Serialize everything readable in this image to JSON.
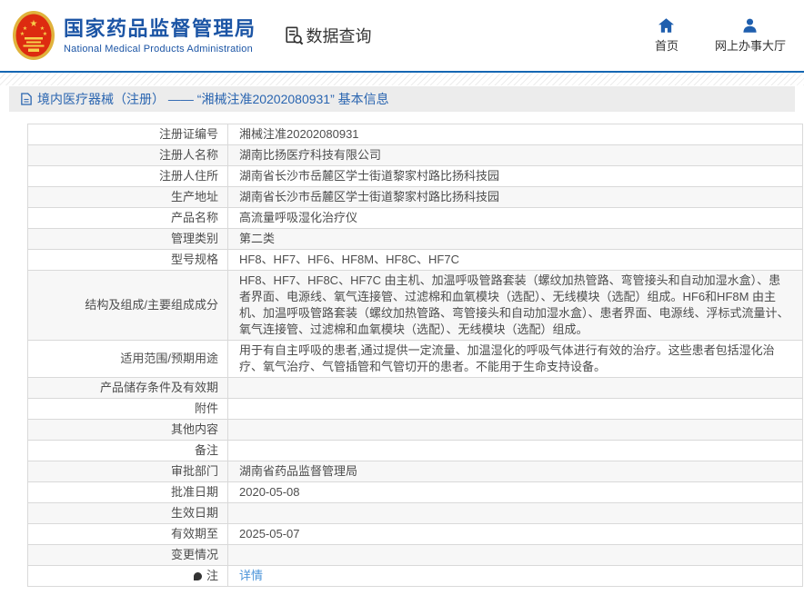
{
  "header": {
    "org_name_cn": "国家药品监督管理局",
    "org_name_en": "National Medical Products Administration",
    "section_title": "数据查询",
    "nav": [
      {
        "label": "首页",
        "icon": "home-icon"
      },
      {
        "label": "网上办事大厅",
        "icon": "person-icon"
      }
    ]
  },
  "breadcrumb": {
    "text": "境内医疗器械（注册） —— “湘械注准20202080931” 基本信息"
  },
  "table": {
    "rows": [
      {
        "label": "注册证编号",
        "value": "湘械注准20202080931"
      },
      {
        "label": "注册人名称",
        "value": "湖南比扬医疗科技有限公司"
      },
      {
        "label": "注册人住所",
        "value": "湖南省长沙市岳麓区学士街道黎家村路比扬科技园"
      },
      {
        "label": "生产地址",
        "value": "湖南省长沙市岳麓区学士街道黎家村路比扬科技园"
      },
      {
        "label": "产品名称",
        "value": "高流量呼吸湿化治疗仪"
      },
      {
        "label": "管理类别",
        "value": "第二类"
      },
      {
        "label": "型号规格",
        "value": "HF8、HF7、HF6、HF8M、HF8C、HF7C"
      },
      {
        "label": "结构及组成/主要组成成分",
        "value": "HF8、HF7、HF8C、HF7C 由主机、加温呼吸管路套装（螺纹加热管路、弯管接头和自动加湿水盒）、患者界面、电源线、氧气连接管、过滤棉和血氧模块（选配）、无线模块（选配）组成。HF6和HF8M 由主机、加温呼吸管路套装（螺纹加热管路、弯管接头和自动加湿水盒）、患者界面、电源线、浮标式流量计、氧气连接管、过滤棉和血氧模块（选配）、无线模块（选配）组成。"
      },
      {
        "label": "适用范围/预期用途",
        "value": "用于有自主呼吸的患者,通过提供一定流量、加温湿化的呼吸气体进行有效的治疗。这些患者包括湿化治疗、氧气治疗、气管插管和气管切开的患者。不能用于生命支持设备。"
      },
      {
        "label": "产品储存条件及有效期",
        "value": ""
      },
      {
        "label": "附件",
        "value": ""
      },
      {
        "label": "其他内容",
        "value": ""
      },
      {
        "label": "备注",
        "value": ""
      },
      {
        "label": "审批部门",
        "value": "湖南省药品监督管理局"
      },
      {
        "label": "批准日期",
        "value": "2020-05-08"
      },
      {
        "label": "生效日期",
        "value": ""
      },
      {
        "label": "有效期至",
        "value": "2025-05-07"
      },
      {
        "label": "变更情况",
        "value": ""
      },
      {
        "label": "注",
        "value": "详情"
      }
    ]
  },
  "colors": {
    "brand_blue": "#1c55a5",
    "rule_blue": "#1567b3",
    "icon_blue": "#1f5fae",
    "breadcrumb_blue": "#2a65b0",
    "link_blue": "#4c94d9",
    "stripe_gray": "#f7f7f7",
    "border_gray": "#d9d9d9",
    "emblem_red": "#dd2b10",
    "emblem_gold": "#f2c141"
  }
}
